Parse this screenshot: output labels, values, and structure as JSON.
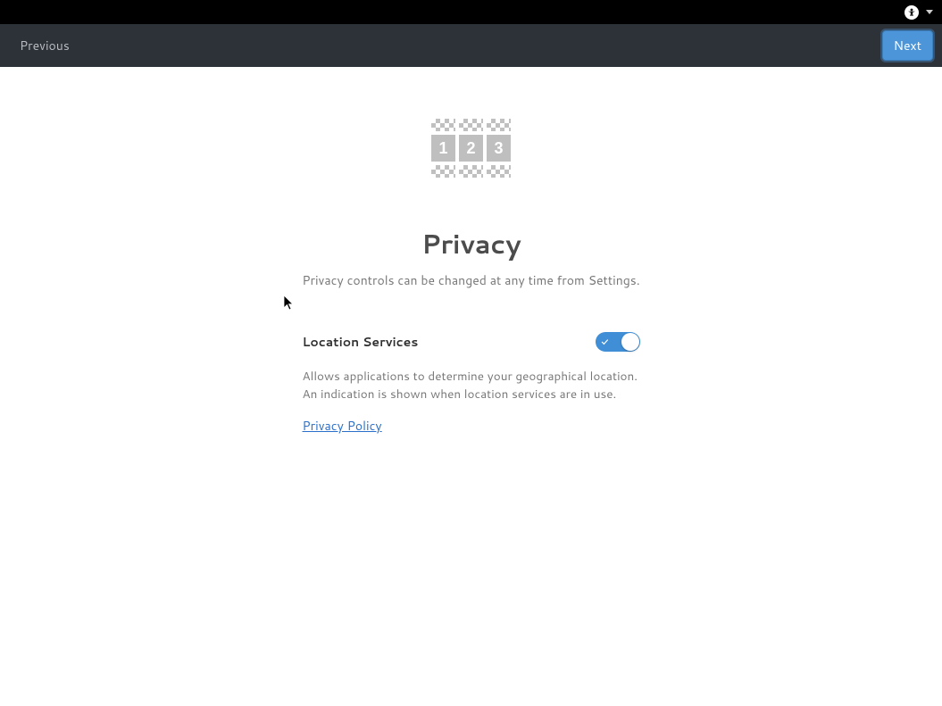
{
  "topbar": {
    "accessibility_icon": "accessibility"
  },
  "nav": {
    "previous_label": "Previous",
    "next_label": "Next"
  },
  "hero": {
    "blocks": [
      "1",
      "2",
      "3"
    ]
  },
  "page": {
    "title": "Privacy",
    "subtitle": "Privacy controls can be changed at any time from Settings."
  },
  "setting": {
    "title": "Location Services",
    "toggle_on": true,
    "description": "Allows applications to determine your geographical location. An indication is shown when location services are in use.",
    "policy_link_label": "Privacy Policy"
  }
}
